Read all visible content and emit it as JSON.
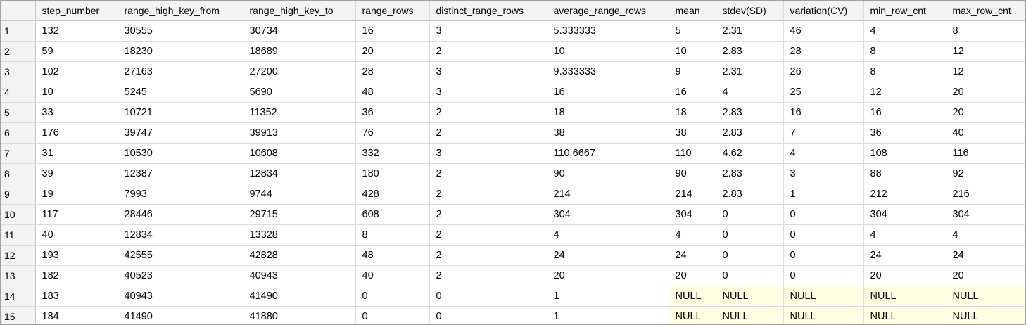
{
  "results_grid": {
    "columns": [
      "",
      "step_number",
      "range_high_key_from",
      "range_high_key_to",
      "range_rows",
      "distinct_range_rows",
      "average_range_rows",
      "mean",
      "stdev(SD)",
      "variation(CV)",
      "min_row_cnt",
      "max_row_cnt"
    ],
    "rows": [
      [
        "1",
        "132",
        "30555",
        "30734",
        "16",
        "3",
        "5.333333",
        "5",
        "2.31",
        "46",
        "4",
        "8"
      ],
      [
        "2",
        "59",
        "18230",
        "18689",
        "20",
        "2",
        "10",
        "10",
        "2.83",
        "28",
        "8",
        "12"
      ],
      [
        "3",
        "102",
        "27163",
        "27200",
        "28",
        "3",
        "9.333333",
        "9",
        "2.31",
        "26",
        "8",
        "12"
      ],
      [
        "4",
        "10",
        "5245",
        "5690",
        "48",
        "3",
        "16",
        "16",
        "4",
        "25",
        "12",
        "20"
      ],
      [
        "5",
        "33",
        "10721",
        "11352",
        "36",
        "2",
        "18",
        "18",
        "2.83",
        "16",
        "16",
        "20"
      ],
      [
        "6",
        "176",
        "39747",
        "39913",
        "76",
        "2",
        "38",
        "38",
        "2.83",
        "7",
        "36",
        "40"
      ],
      [
        "7",
        "31",
        "10530",
        "10608",
        "332",
        "3",
        "110.6667",
        "110",
        "4.62",
        "4",
        "108",
        "116"
      ],
      [
        "8",
        "39",
        "12387",
        "12834",
        "180",
        "2",
        "90",
        "90",
        "2.83",
        "3",
        "88",
        "92"
      ],
      [
        "9",
        "19",
        "7993",
        "9744",
        "428",
        "2",
        "214",
        "214",
        "2.83",
        "1",
        "212",
        "216"
      ],
      [
        "10",
        "117",
        "28446",
        "29715",
        "608",
        "2",
        "304",
        "304",
        "0",
        "0",
        "304",
        "304"
      ],
      [
        "11",
        "40",
        "12834",
        "13328",
        "8",
        "2",
        "4",
        "4",
        "0",
        "0",
        "4",
        "4"
      ],
      [
        "12",
        "193",
        "42555",
        "42828",
        "48",
        "2",
        "24",
        "24",
        "0",
        "0",
        "24",
        "24"
      ],
      [
        "13",
        "182",
        "40523",
        "40943",
        "40",
        "2",
        "20",
        "20",
        "0",
        "0",
        "20",
        "20"
      ],
      [
        "14",
        "183",
        "40943",
        "41490",
        "0",
        "0",
        "1",
        "NULL",
        "NULL",
        "NULL",
        "NULL",
        "NULL"
      ],
      [
        "15",
        "184",
        "41490",
        "41880",
        "0",
        "0",
        "1",
        "NULL",
        "NULL",
        "NULL",
        "NULL",
        "NULL"
      ]
    ],
    "null_highlight_color": "#ffffe1",
    "header_background": "#f3f3f3"
  }
}
